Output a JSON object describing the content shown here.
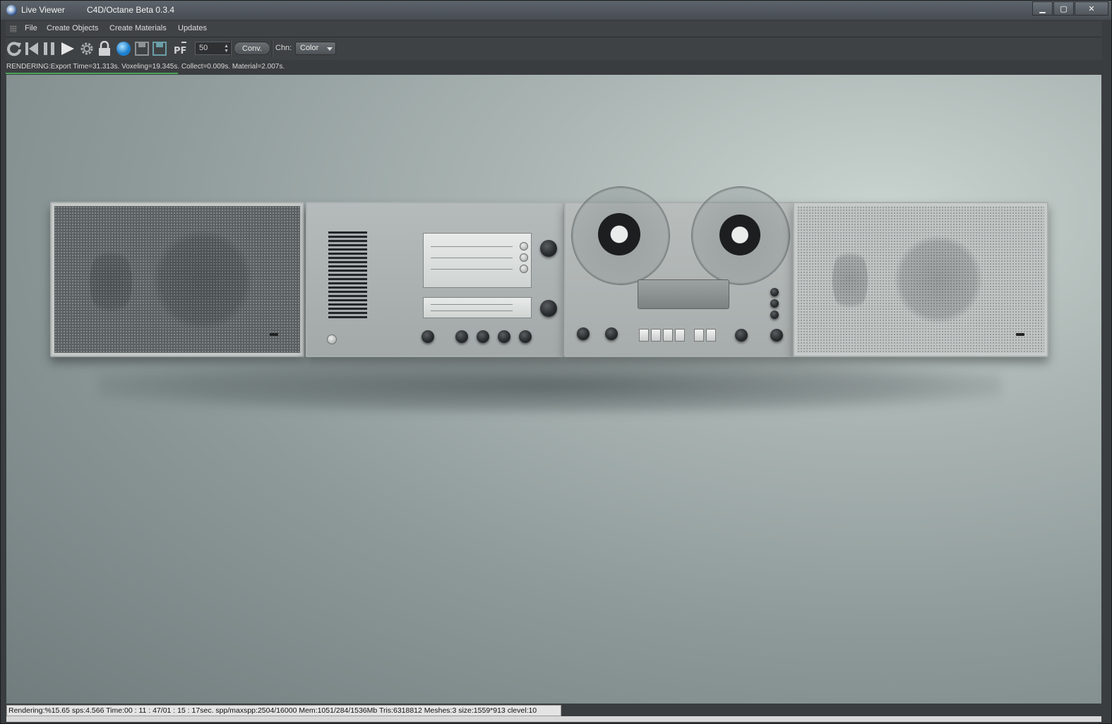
{
  "window": {
    "title": "Live Viewer",
    "subtitle": "C4D/Octane Beta 0.3.4",
    "controls": {
      "minimize": "▁",
      "maximize": "▢",
      "close": "✕"
    }
  },
  "menu": {
    "items": [
      {
        "label": "File"
      },
      {
        "label": "Create Objects"
      },
      {
        "label": "Create Materials"
      },
      {
        "label": "Updates"
      }
    ]
  },
  "toolbar": {
    "icons": [
      "refresh-icon",
      "restart-icon",
      "pause-icon",
      "play-icon",
      "settings-gear-icon",
      "lock-icon",
      "sphere-preview-icon",
      "save-icon",
      "save-multilayer-icon",
      "pf-icon"
    ],
    "samples_value": "50",
    "conv_label": "Conv.",
    "channel_label": "Chn:",
    "channel_value": "Color"
  },
  "status_top": {
    "text": "RENDERING:Export Time=31.313s.  Voxeling=19.345s.  Collect=0.009s.  Material=2.007s.",
    "progress_fraction": 0.157
  },
  "status_bottom": {
    "text": "Rendering:%15.65 sps:4.566 Time:00 : 11 : 47/01 : 15 : 17sec. spp/maxspp:2504/16000 Mem:1051/284/1536Mb Tris:6318812 Meshes:3 size:1559*913 clevel:10"
  },
  "colors": {
    "accent_progress": "#4aa55a",
    "titlebar": "#50565c",
    "panel": "#3f4244"
  }
}
